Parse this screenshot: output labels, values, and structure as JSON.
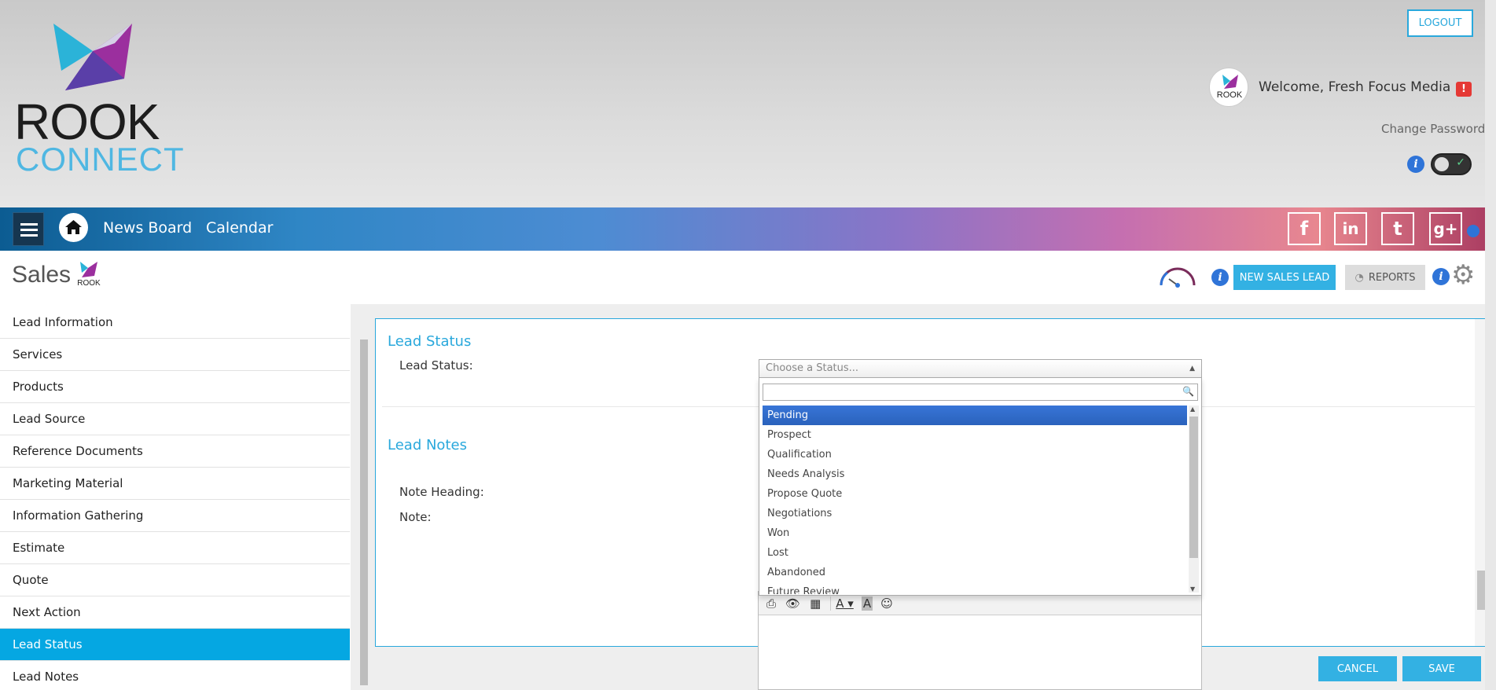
{
  "header": {
    "logo_line1": "ROOK",
    "logo_line2": "CONNECT",
    "logout_label": "LOGOUT",
    "welcome_text": "Welcome, Fresh Focus Media",
    "alert_badge": "!",
    "change_password": "Change Password",
    "info_glyph": "i"
  },
  "navbar": {
    "links": [
      "News Board",
      "Calendar"
    ],
    "social": [
      {
        "name": "facebook-icon",
        "glyph": "f"
      },
      {
        "name": "linkedin-icon",
        "glyph": "in"
      },
      {
        "name": "twitter-icon",
        "glyph": "t"
      },
      {
        "name": "google-plus-icon",
        "glyph": "g+"
      }
    ]
  },
  "subheader": {
    "title": "Sales",
    "new_sales_lead": "NEW SALES LEAD",
    "reports": "REPORTS"
  },
  "sidebar": {
    "items": [
      "Lead Information",
      "Services",
      "Products",
      "Lead Source",
      "Reference Documents",
      "Marketing Material",
      "Information Gathering",
      "Estimate",
      "Quote",
      "Next Action",
      "Lead Status",
      "Lead Notes"
    ],
    "active_item": "Lead Status"
  },
  "panel": {
    "lead_status_title": "Lead Status",
    "lead_status_label": "Lead Status:",
    "lead_notes_title": "Lead Notes",
    "note_heading_label": "Note Heading:",
    "note_label": "Note:"
  },
  "status_select": {
    "placeholder": "Choose a Status...",
    "search_value": "",
    "options": [
      "Pending",
      "Prospect",
      "Qualification",
      "Needs Analysis",
      "Propose Quote",
      "Negotiations",
      "Won",
      "Lost",
      "Abandoned",
      "Future Review"
    ],
    "highlighted": "Pending"
  },
  "footer": {
    "cancel": "CANCEL",
    "save": "SAVE"
  },
  "colors": {
    "accent": "#29a8dc",
    "active_sidebar": "#05a7e2",
    "dropdown_highlight": "#3875d7"
  }
}
